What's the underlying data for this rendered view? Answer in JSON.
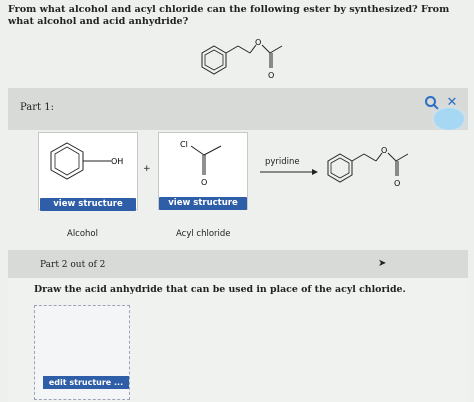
{
  "question": {
    "text": "From what alcohol and acyl chloride can the following ester by synthesized? From what alcohol and acid anhydride?"
  },
  "part1": {
    "label": "Part 1:",
    "alcohol": {
      "oh_label": "OH",
      "button": "view structure",
      "caption": "Alcohol"
    },
    "plus": "+",
    "acyl_chloride": {
      "cl_label": "Cl",
      "o_label": "O",
      "button": "view structure",
      "caption": "Acyl chloride"
    },
    "reagent": "pyridine",
    "product": {
      "o_label_ring": "O",
      "o_label_carbonyl": "O"
    },
    "top_molecule": {
      "o_label_ester": "O",
      "o_label_carbonyl": "O"
    },
    "icons": [
      "search-icon",
      "close-icon"
    ]
  },
  "part2": {
    "label": "Part 2 out of 2",
    "question": "Draw the acid anhydride that can be used in place of the acyl chloride.",
    "edit_button": "edit structure ..."
  },
  "colors": {
    "button_blue": "#2f5ea8",
    "accent_blue": "#2a6fc4",
    "bar_gray": "#d8dad8"
  }
}
